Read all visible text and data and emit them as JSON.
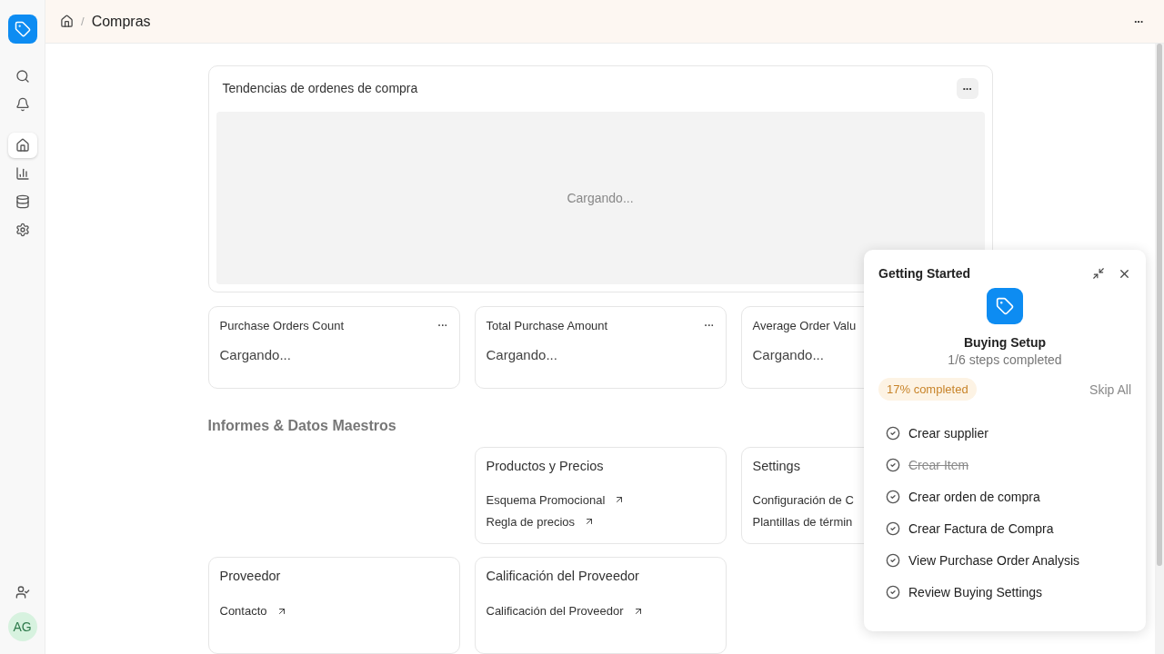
{
  "sidebar": {
    "nav_items": [
      {
        "selected": true
      },
      {
        "selected": false
      },
      {
        "selected": false
      },
      {
        "selected": false
      }
    ],
    "avatar": "AG"
  },
  "breadcrumb": {
    "separator": "/",
    "current": "Compras",
    "menu": "···"
  },
  "trend_card": {
    "title": "Tendencias de ordenes de compra",
    "menu": "···",
    "loading": "Cargando..."
  },
  "kpi_cards": [
    {
      "title": "Purchase Orders Count",
      "menu": "···",
      "value": "Cargando..."
    },
    {
      "title": "Total Purchase Amount",
      "menu": "···",
      "value": "Cargando..."
    },
    {
      "title": "Average Order Valu",
      "value": "Cargando..."
    }
  ],
  "section_title": "Informes & Datos Maestros",
  "link_cards": [
    {
      "kind": "empty"
    },
    {
      "kind": "card",
      "title": "Productos y Precios",
      "links": [
        {
          "label": "Esquema Promocional",
          "arrow": true
        },
        {
          "label": "Regla de precios",
          "arrow": true
        }
      ]
    },
    {
      "kind": "card",
      "title": "Settings",
      "links": [
        {
          "label": "Configuración de C",
          "arrow": false
        },
        {
          "label": "Plantillas de términ",
          "arrow": false
        }
      ]
    },
    {
      "kind": "card",
      "title": "Proveedor",
      "links": [
        {
          "label": "Contacto",
          "arrow": true
        }
      ]
    },
    {
      "kind": "card",
      "title": "Calificación del Proveedor",
      "links": [
        {
          "label": "Calificación del Proveedor",
          "arrow": true
        }
      ]
    }
  ],
  "getting_started": {
    "title": "Getting Started",
    "setup_title": "Buying Setup",
    "steps_text": "1/6 steps completed",
    "progress_badge": "17% completed",
    "skip": "Skip All",
    "steps": [
      {
        "label": "Crear supplier",
        "completed": false
      },
      {
        "label": "Crear Item",
        "completed": true
      },
      {
        "label": "Crear orden de compra",
        "completed": false
      },
      {
        "label": "Crear Factura de Compra",
        "completed": false
      },
      {
        "label": "View Purchase Order Analysis",
        "completed": false
      },
      {
        "label": "Review Buying Settings",
        "completed": false
      }
    ]
  }
}
